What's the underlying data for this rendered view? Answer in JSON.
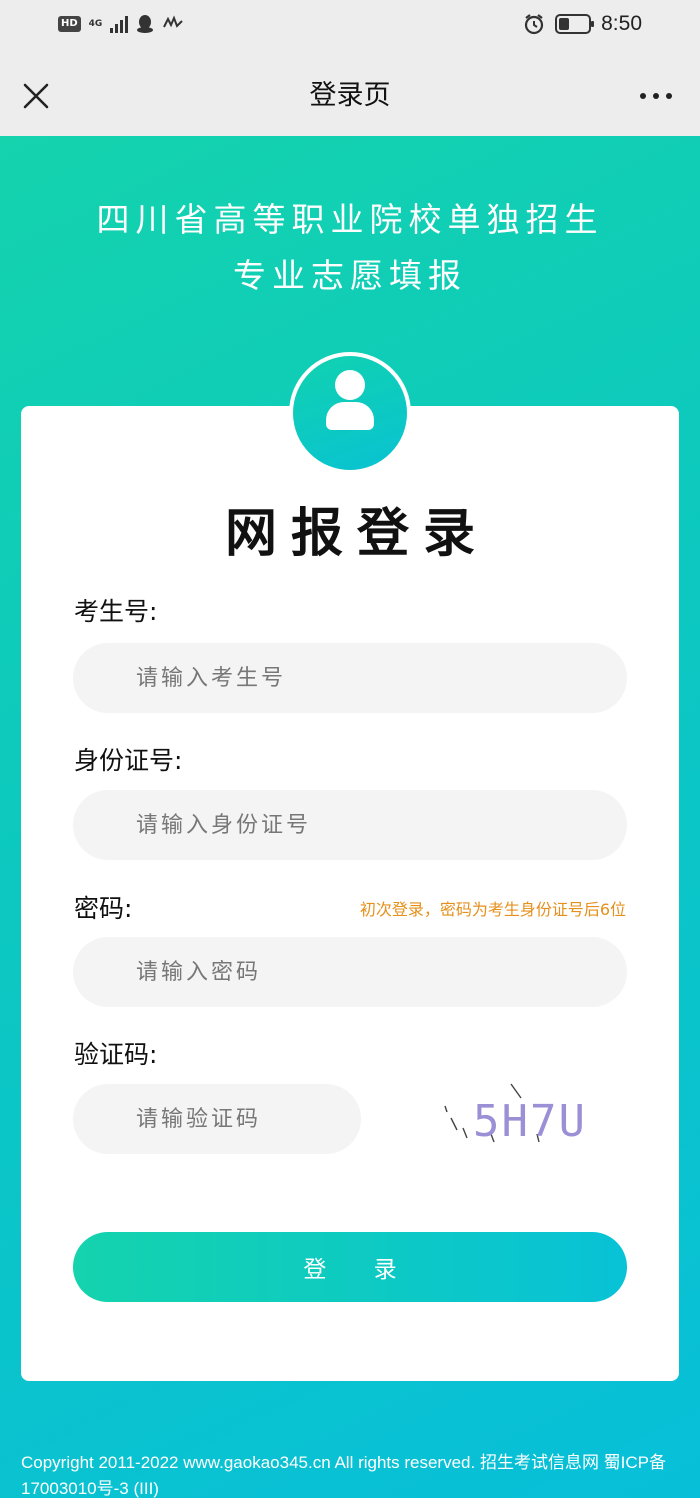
{
  "status_bar": {
    "hd": "HD",
    "network": "4G",
    "time": "8:50",
    "icons": [
      "hd-icon",
      "signal-icon",
      "qq-icon",
      "app-notification-icon",
      "alarm-icon",
      "battery-icon"
    ]
  },
  "title_bar": {
    "title": "登录页",
    "icons": [
      "close-icon",
      "more-icon"
    ]
  },
  "heading": {
    "line1": "四川省高等职业院校单独招生",
    "line2": "专业志愿填报"
  },
  "form": {
    "title": "网报登录",
    "exam_number": {
      "label": "考生号:",
      "placeholder": "请输入考生号",
      "value": ""
    },
    "id_number": {
      "label": "身份证号:",
      "placeholder": "请输入身份证号",
      "value": ""
    },
    "password": {
      "label": "密码:",
      "placeholder": "请输入密码",
      "value": "",
      "hint": "初次登录，密码为考生身份证号后6位"
    },
    "captcha": {
      "label": "验证码:",
      "placeholder": "请输验证码",
      "value": "",
      "code": "5H7U"
    },
    "submit_label": "登 录"
  },
  "colors": {
    "gradient_start": "#14d3ad",
    "gradient_end": "#08bfd9",
    "hint": "#e5901c",
    "input_bg": "#f4f4f4",
    "captcha_text": "#9b8fd6"
  },
  "footer": {
    "copyright": "Copyright 2011-2022 www.gaokao345.cn All rights reserved. 招生考试信息网 蜀ICP备17003010号-3 (III)"
  }
}
